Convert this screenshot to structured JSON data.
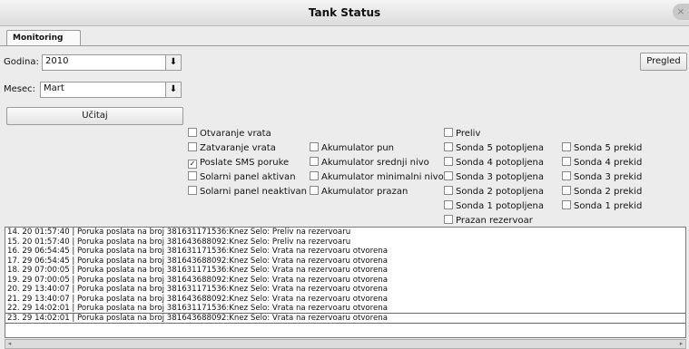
{
  "window": {
    "title": "Tank Status",
    "close_glyph": "×"
  },
  "tabs": [
    {
      "label": "Monitoring",
      "active": true
    }
  ],
  "godina": {
    "label": "Godina:",
    "value": "2010",
    "arrow": "⬇"
  },
  "mesec": {
    "label": "Mesec:",
    "value": "Mart",
    "arrow": "⬇"
  },
  "buttons": {
    "ucitaj": "Učitaj",
    "pregled": "Pregled"
  },
  "checkboxes": {
    "col1": [
      {
        "label": "Otvaranje vrata",
        "checked": false
      },
      {
        "label": "Zatvaranje vrata",
        "checked": false
      },
      {
        "label": "Poslate SMS poruke",
        "checked": true
      },
      {
        "label": "Solarni panel aktivan",
        "checked": false
      },
      {
        "label": "Solarni panel neaktivan",
        "checked": false
      }
    ],
    "col2": [
      {
        "label": "Akumulator pun",
        "checked": false
      },
      {
        "label": "Akumulator srednji nivo",
        "checked": false
      },
      {
        "label": "Akumulator minimalni nivo",
        "checked": false
      },
      {
        "label": "Akumulator prazan",
        "checked": false
      }
    ],
    "col3": [
      {
        "label": "Preliv",
        "checked": false
      },
      {
        "label": "Sonda 5 potopljena",
        "checked": false
      },
      {
        "label": "Sonda 4 potopljena",
        "checked": false
      },
      {
        "label": "Sonda 3 potopljena",
        "checked": false
      },
      {
        "label": "Sonda 2 potopljena",
        "checked": false
      },
      {
        "label": "Sonda 1 potopljena",
        "checked": false
      },
      {
        "label": "Prazan rezervoar",
        "checked": false
      }
    ],
    "col4": [
      {
        "label": "Sonda 5 prekid",
        "checked": false
      },
      {
        "label": "Sonda 4 prekid",
        "checked": false
      },
      {
        "label": "Sonda 3 prekid",
        "checked": false
      },
      {
        "label": "Sonda 2 prekid",
        "checked": false
      },
      {
        "label": "Sonda 1 prekid",
        "checked": false
      }
    ]
  },
  "log": [
    "14. 20 01:57:40 | Poruka poslata na broj 381631171536:Knez Selo: Preliv na rezervoaru",
    "15. 20 01:57:40 | Poruka poslata na broj 381643688092:Knez Selo: Preliv na rezervoaru",
    "16. 29 06:54:45 | Poruka poslata na broj 381631171536:Knez Selo: Vrata na rezervoaru otvorena",
    "17. 29 06:54:45 | Poruka poslata na broj 381643688092:Knez Selo: Vrata na rezervoaru otvorena",
    "18. 29 07:00:05 | Poruka poslata na broj 381631171536:Knez Selo: Vrata na rezervoaru otvorena",
    "19. 29 07:00:05 | Poruka poslata na broj 381643688092:Knez Selo: Vrata na rezervoaru otvorena",
    "20. 29 13:40:07 | Poruka poslata na broj 381631171536:Knez Selo: Vrata na rezervoaru otvorena",
    "21. 29 13:40:07 | Poruka poslata na broj 381643688092:Knez Selo: Vrata na rezervoaru otvorena",
    "22. 29 14:02:01 | Poruka poslata na broj 381631171536:Knez Selo: Vrata na rezervoaru otvorena",
    "23. 29 14:02:01 | Poruka poslata na broj 381643688092:Knez Selo: Vrata na rezervoaru otvorena"
  ],
  "scroll": {
    "left_arrow": "◂",
    "right_arrow": "▸"
  }
}
